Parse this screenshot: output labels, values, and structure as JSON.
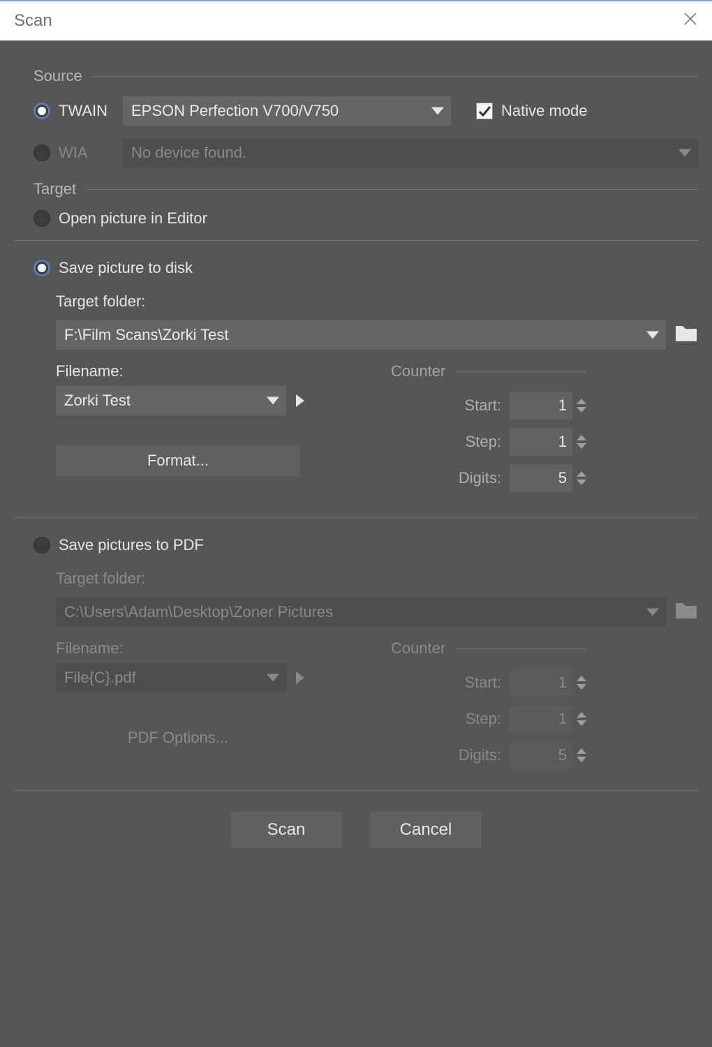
{
  "window": {
    "title": "Scan"
  },
  "source": {
    "legend": "Source",
    "twain_label": "TWAIN",
    "twain_selected": true,
    "twain_device": "EPSON Perfection V700/V750",
    "native_mode_label": "Native mode",
    "native_mode_checked": true,
    "wia_label": "WIA",
    "wia_device": "No device found."
  },
  "target": {
    "legend": "Target",
    "open_editor_label": "Open picture in Editor",
    "save_disk": {
      "label": "Save picture to disk",
      "selected": true,
      "target_folder_label": "Target folder:",
      "target_folder": "F:\\Film Scans\\Zorki Test",
      "filename_label": "Filename:",
      "filename": "Zorki Test",
      "format_button": "Format...",
      "counter": {
        "legend": "Counter",
        "start_label": "Start:",
        "step_label": "Step:",
        "digits_label": "Digits:",
        "start": "1",
        "step": "1",
        "digits": "5"
      }
    },
    "save_pdf": {
      "label": "Save pictures to PDF",
      "target_folder_label": "Target folder:",
      "target_folder": "C:\\Users\\Adam\\Desktop\\Zoner Pictures",
      "filename_label": "Filename:",
      "filename": "File{C}.pdf",
      "pdf_options_button": "PDF Options...",
      "counter": {
        "legend": "Counter",
        "start_label": "Start:",
        "step_label": "Step:",
        "digits_label": "Digits:",
        "start": "1",
        "step": "1",
        "digits": "5"
      }
    }
  },
  "footer": {
    "scan": "Scan",
    "cancel": "Cancel"
  }
}
